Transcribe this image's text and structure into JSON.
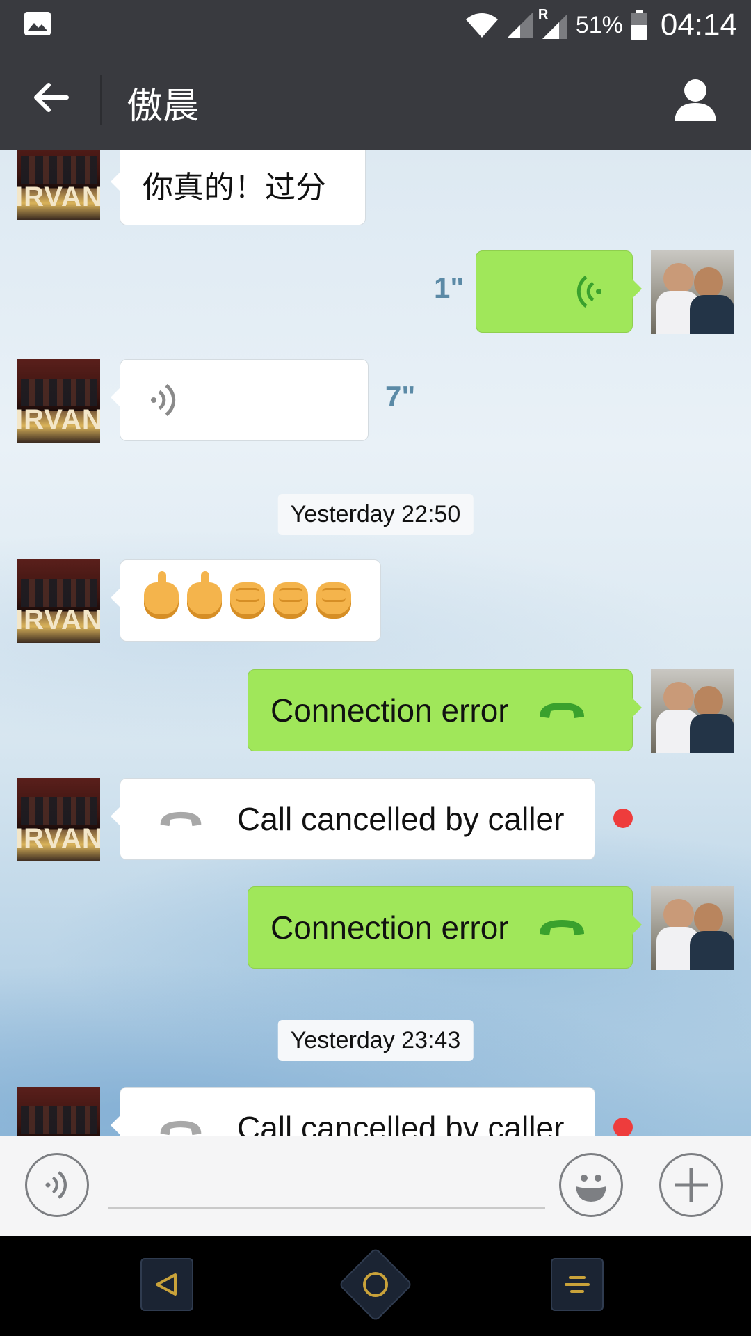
{
  "status_bar": {
    "icons": [
      "gallery-icon",
      "wifi-icon",
      "signal-icon",
      "roaming-signal-icon",
      "battery-icon"
    ],
    "roaming_label": "R",
    "battery_percent": "51%",
    "time": "04:14"
  },
  "header": {
    "title": "傲晨",
    "back_icon": "arrow-left-icon",
    "profile_icon": "person-icon"
  },
  "messages": [
    {
      "side": "them",
      "type": "text",
      "text": "你真的！过分"
    },
    {
      "side": "me",
      "type": "voice",
      "duration": "1\""
    },
    {
      "side": "them",
      "type": "voice",
      "duration": "7\""
    },
    {
      "type": "timestamp",
      "text": "Yesterday 22:50"
    },
    {
      "side": "them",
      "type": "emoji",
      "emojis": [
        "pointing-up-hand",
        "pointing-up-hand",
        "raised-fist",
        "raised-fist",
        "raised-fist"
      ]
    },
    {
      "side": "me",
      "type": "call",
      "text": "Connection error",
      "icon": "phone-hangup-icon"
    },
    {
      "side": "them",
      "type": "call",
      "text": "Call cancelled by caller",
      "icon": "phone-hangup-icon",
      "unread": true
    },
    {
      "side": "me",
      "type": "call",
      "text": "Connection error",
      "icon": "phone-hangup-icon"
    },
    {
      "type": "timestamp",
      "text": "Yesterday 23:43"
    },
    {
      "side": "them",
      "type": "call",
      "text": "Call cancelled by caller",
      "icon": "phone-hangup-icon",
      "unread": true
    }
  ],
  "input_bar": {
    "voice_icon": "voice-input-icon",
    "text_value": "",
    "emoji_icon": "smiley-icon",
    "more_icon": "plus-icon"
  },
  "nav_bar": {
    "icons": [
      "nav-back-icon",
      "nav-home-icon",
      "nav-recents-icon"
    ]
  },
  "colors": {
    "header_bg": "#393a3f",
    "outgoing_bubble": "#a0e75a",
    "incoming_bubble": "#ffffff",
    "duration_text": "#5b8aa6",
    "unread_dot": "#ee3c3c"
  }
}
